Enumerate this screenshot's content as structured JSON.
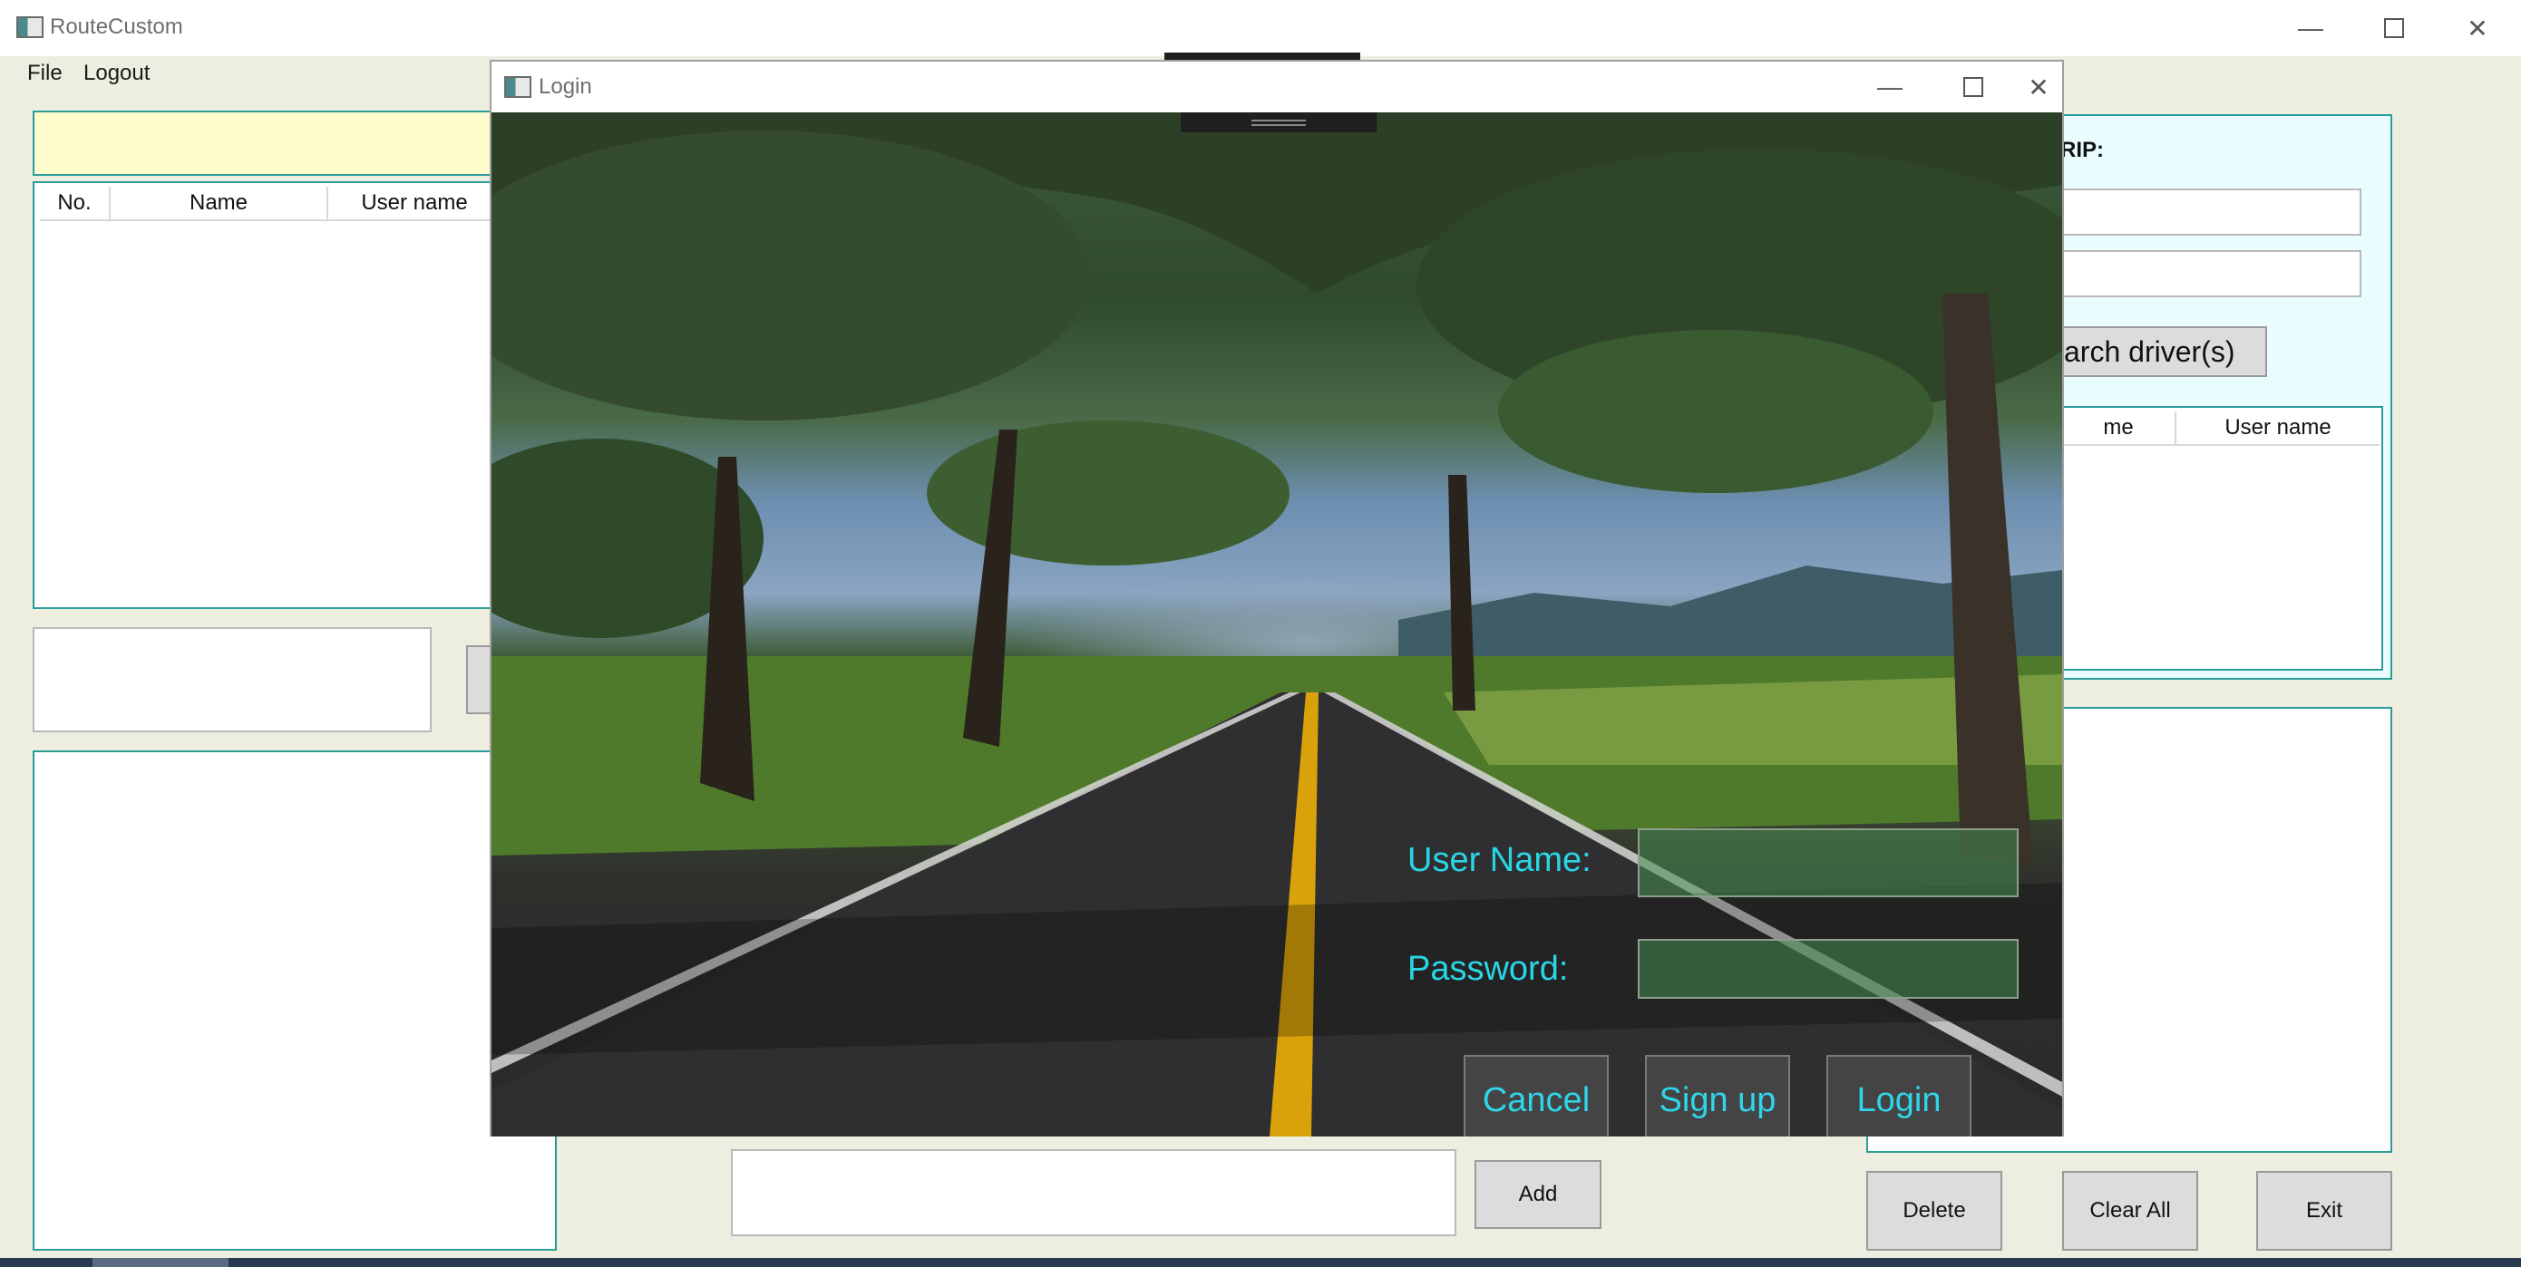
{
  "window": {
    "title": "RouteCustom"
  },
  "menu": {
    "file": "File",
    "logout": "Logout"
  },
  "left": {
    "columns": [
      "No.",
      "Name",
      "User name"
    ]
  },
  "right": {
    "trip_label": "RIP:",
    "search_button": "arch driver(s)",
    "columns": [
      "me",
      "User name"
    ]
  },
  "bottom": {
    "add_button": "Add",
    "delete_button": "Delete",
    "clear_all_button": "Clear All",
    "exit_button": "Exit"
  },
  "login": {
    "title": "Login",
    "username_label": "User Name:",
    "password_label": "Password:",
    "cancel_button": "Cancel",
    "signup_button": "Sign up",
    "login_button": "Login"
  },
  "icons": {
    "minimize": "minimize-icon",
    "maximize": "maximize-icon",
    "close": "close-icon"
  }
}
